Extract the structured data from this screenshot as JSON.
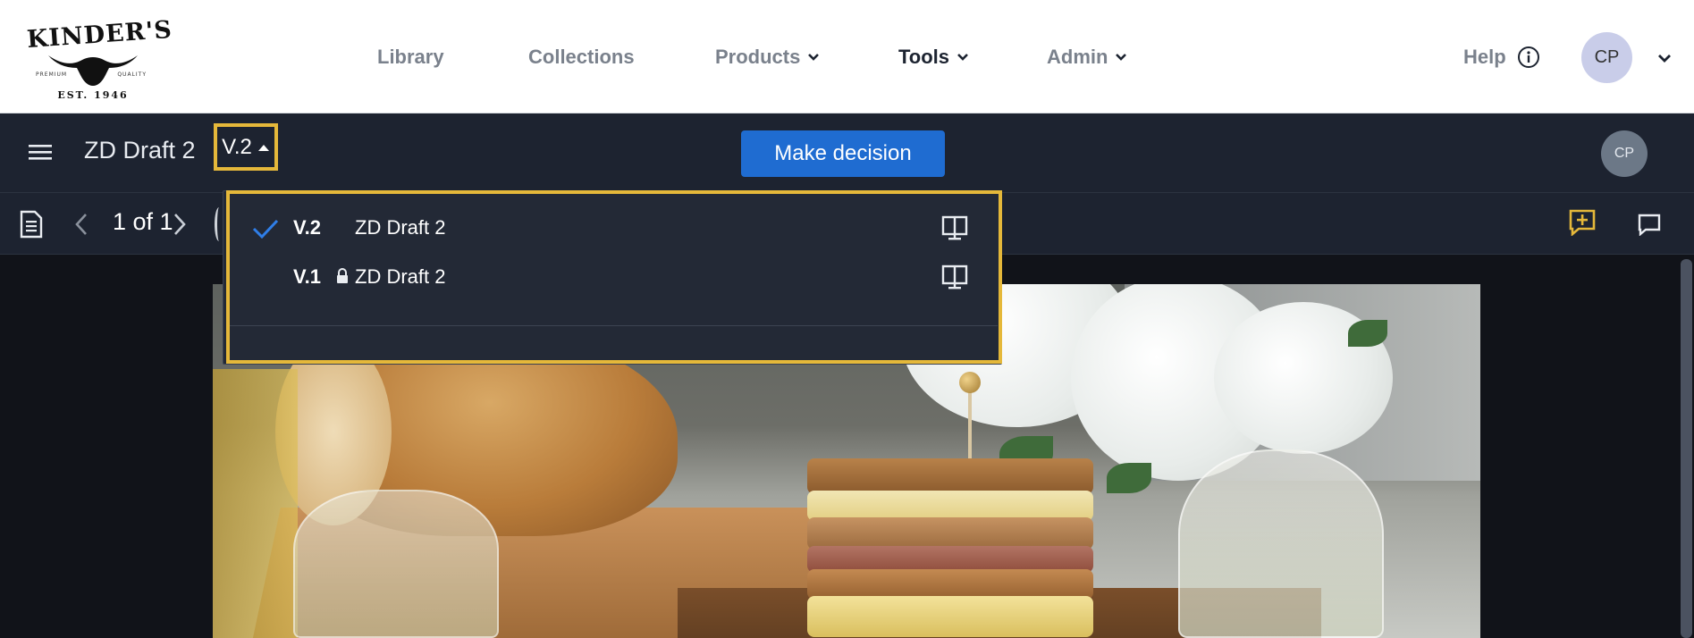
{
  "brand": {
    "logo_text": "KINDER'S",
    "logo_sub_left": "PREMIUM",
    "logo_sub_right": "QUALITY",
    "logo_est": "EST. 1946"
  },
  "nav": {
    "items": [
      {
        "label": "Library",
        "has_menu": false,
        "active": false
      },
      {
        "label": "Collections",
        "has_menu": false,
        "active": false
      },
      {
        "label": "Products",
        "has_menu": true,
        "active": false
      },
      {
        "label": "Tools",
        "has_menu": true,
        "active": true
      },
      {
        "label": "Admin",
        "has_menu": true,
        "active": false
      }
    ],
    "help_label": "Help",
    "user_initials": "CP"
  },
  "toolbar": {
    "doc_title": "ZD Draft 2",
    "version_label": "V.2",
    "decision_label": "Make decision",
    "reviewer_initials": "CP"
  },
  "pager": {
    "page_text": "1 of 1"
  },
  "versions": {
    "items": [
      {
        "version": "V.2",
        "name": "ZD Draft 2",
        "selected": true,
        "locked": false
      },
      {
        "version": "V.1",
        "name": "ZD Draft 2",
        "selected": false,
        "locked": true
      }
    ]
  },
  "colors": {
    "accent_blue": "#1f6cd1",
    "highlight_yellow": "#e5b83a",
    "dark_bg": "#1d2330"
  },
  "icons": [
    "hamburger-icon",
    "caret-up-icon",
    "pages-icon",
    "chevron-left-icon",
    "chevron-right-icon",
    "add-comment-icon",
    "comment-icon",
    "check-icon",
    "lock-icon",
    "compare-icon",
    "info-icon",
    "chevron-down-icon"
  ]
}
